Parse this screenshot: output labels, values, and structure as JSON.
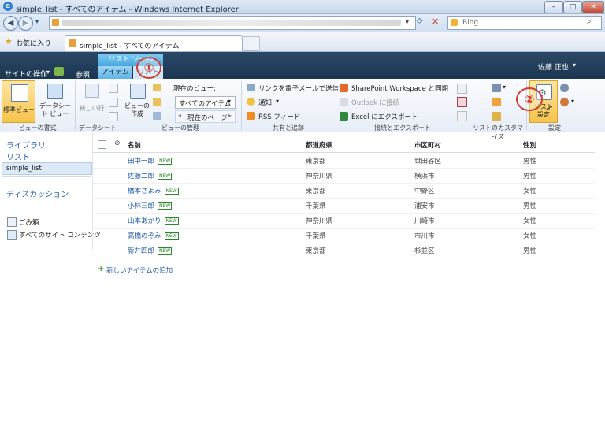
{
  "window": {
    "title": "simple_list - すべてのアイテム - Windows Internet Explorer"
  },
  "browser": {
    "search_provider": "Bing",
    "favorites_label": "お気に入り",
    "tab_title": "simple_list - すべてのアイテム"
  },
  "sharepoint": {
    "site_actions": "サイトの操作",
    "browse": "参照",
    "list_tools": "リスト ツール",
    "tab_items": "アイテム",
    "tab_list": "リスト",
    "user": "佐藤 正也"
  },
  "ribbon": {
    "standard_view": "標準ビュー",
    "datasheet_view": "データシート ビュー",
    "new_row": "新しい行",
    "create_view": "ビューの作成",
    "current_view_label": "現在のビュー:",
    "current_view_value": "すべてのアイテム",
    "current_page": "現在のページ",
    "email_link": "リンクを電子メールで送信",
    "alert": "通知",
    "rss": "RSS フィード",
    "sp_workspace": "SharePoint Workspace と同期",
    "outlook": "Outlook に接続",
    "excel": "Excel にエクスポート",
    "list_settings": "リスト 設定",
    "groups": {
      "view_format": "ビューの書式",
      "datasheet": "データシート",
      "view_mgmt": "ビューの管理",
      "share_track": "共有と追跡",
      "connect_export": "接続とエクスポート",
      "customize": "リストのカスタマイズ",
      "settings": "設定"
    }
  },
  "callouts": {
    "one": "①",
    "two": "②"
  },
  "leftnav": {
    "libraries": "ライブラリ",
    "lists": "リスト",
    "selected_list": "simple_list",
    "discussions": "ディスカッション",
    "recycle_bin": "ごみ箱",
    "all_content": "すべてのサイト コンテンツ"
  },
  "table": {
    "columns": [
      "名前",
      "都道府県",
      "市区町村",
      "性別"
    ],
    "rows": [
      [
        "田中一郎",
        "東京都",
        "世田谷区",
        "男性"
      ],
      [
        "佐藤二郎",
        "神奈川県",
        "横浜市",
        "男性"
      ],
      [
        "橋本さよみ",
        "東京都",
        "中野区",
        "女性"
      ],
      [
        "小林三郎",
        "千葉県",
        "浦安市",
        "男性"
      ],
      [
        "山本あかり",
        "神奈川県",
        "川崎市",
        "女性"
      ],
      [
        "高橋のぞみ",
        "千葉県",
        "市川市",
        "女性"
      ],
      [
        "新井四郎",
        "東京都",
        "杉並区",
        "男性"
      ]
    ],
    "new_badge": "NEW",
    "add_item": "新しいアイテムの追加"
  }
}
